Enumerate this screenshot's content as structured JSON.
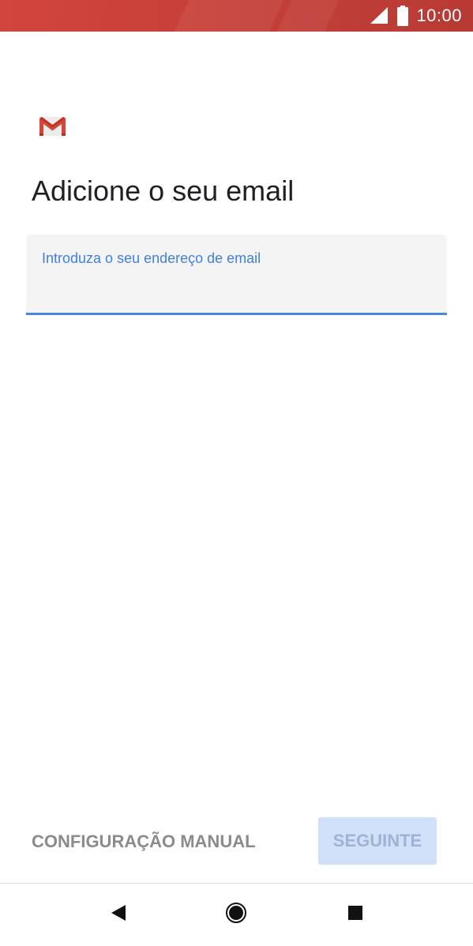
{
  "status_bar": {
    "time": "10:00",
    "signal_icon": "signal-icon",
    "battery_icon": "battery-icon",
    "background_color": "#c8403a"
  },
  "app": {
    "logo_icon": "gmail-logo-icon",
    "title": "Adicione o seu email"
  },
  "email_field": {
    "label": "Introduza o seu endereço de email",
    "value": "",
    "accent_color": "#4a86e0"
  },
  "actions": {
    "manual_setup_label": "CONFIGURAÇÃO MANUAL",
    "next_label": "SEGUINTE",
    "next_enabled": false
  },
  "nav_bar": {
    "back_icon": "back-triangle-icon",
    "home_icon": "home-circle-icon",
    "recents_icon": "recents-square-icon"
  }
}
